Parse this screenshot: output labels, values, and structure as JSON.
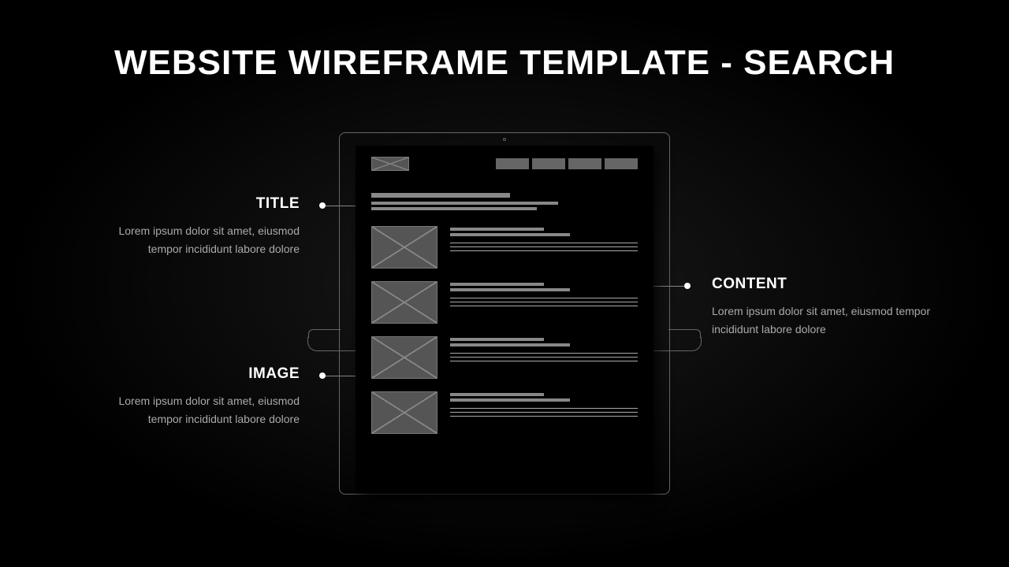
{
  "pageTitle": "WEBSITE WIREFRAME TEMPLATE - SEARCH",
  "annotations": {
    "title": {
      "heading": "TITLE",
      "body": "Lorem ipsum dolor sit amet, eiusmod tempor incididunt labore dolore"
    },
    "image": {
      "heading": "IMAGE",
      "body": "Lorem ipsum dolor sit amet, eiusmod tempor incididunt labore dolore"
    },
    "content": {
      "heading": "CONTENT",
      "body": "Lorem ipsum dolor sit amet, eiusmod tempor incididunt labore dolore"
    }
  }
}
